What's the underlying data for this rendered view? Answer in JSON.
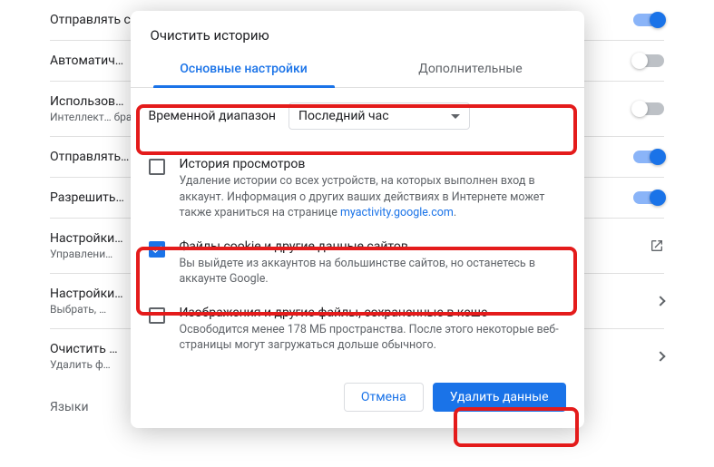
{
  "bg": {
    "rows": [
      {
        "title": "Отправлять системную информацию и содержимое страниц в Google",
        "sub": "",
        "control": "toggle-on"
      },
      {
        "title": "Автоматич…",
        "sub": "",
        "control": "toggle-off"
      },
      {
        "title": "Использов…",
        "sub": "Интеллект… браузере,…",
        "control": "toggle-off"
      },
      {
        "title": "Отправлять…",
        "sub": "",
        "control": "toggle-on"
      },
      {
        "title": "Разрешить…",
        "sub": "",
        "control": "toggle-on"
      },
      {
        "title": "Настройки…",
        "sub": "Управлени…",
        "control": "open"
      },
      {
        "title": "Настройки…",
        "sub": "Выбрать, …",
        "control": "arrow"
      },
      {
        "title": "Очистить …",
        "sub": "Удалить ф…",
        "control": "arrow"
      }
    ],
    "section": "Языки"
  },
  "dialog": {
    "title": "Очистить историю",
    "tabs": {
      "basic": "Основные настройки",
      "advanced": "Дополнительные"
    },
    "range_label": "Временной диапазон",
    "range_value": "Последний час",
    "items": [
      {
        "checked": false,
        "title": "История просмотров",
        "desc_pre": "Удаление истории со всех устройств, на которых выполнен вход в аккаунт. Информация о других ваших действиях в Интернете может также храниться на странице ",
        "desc_link": "myactivity.google.com",
        "desc_post": "."
      },
      {
        "checked": true,
        "title": "Файлы cookie и другие данные сайтов",
        "desc_pre": "Вы выйдете из аккаунтов на большинстве сайтов, но останетесь в аккаунте Google.",
        "desc_link": "",
        "desc_post": ""
      },
      {
        "checked": false,
        "title": "Изображения и другие файлы, сохраненные в кеше",
        "desc_pre": "Освободится менее 178 МБ пространства. После этого некоторые веб-страницы могут загружаться дольше обычного.",
        "desc_link": "",
        "desc_post": ""
      }
    ],
    "cancel": "Отмена",
    "confirm": "Удалить данные"
  }
}
